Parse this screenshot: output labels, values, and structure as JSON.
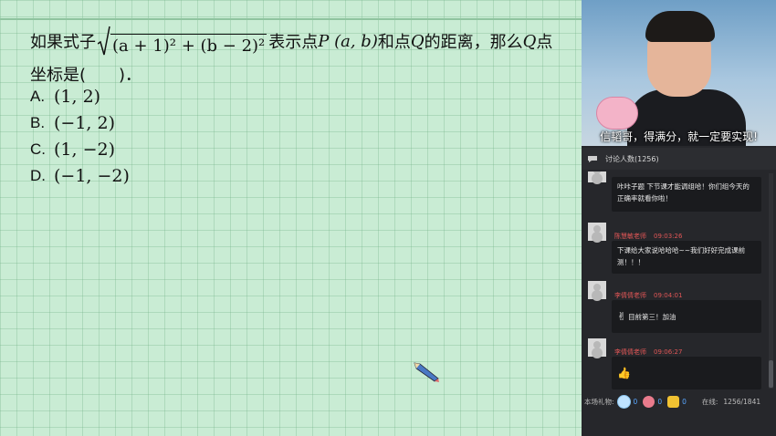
{
  "question": {
    "prefix": "如果式子",
    "radicand": "(a + 1)² + (b − 2)²",
    "middle": "表示点",
    "point_p": "P (a, b)",
    "middle2": "和点",
    "point_q": "Q",
    "suffix": "的距离，那么",
    "q2": "Q",
    "suffix2": "点",
    "line2": "坐标是(　　)．"
  },
  "options": [
    {
      "label": "A.",
      "value": "(1, 2)"
    },
    {
      "label": "B.",
      "value": "(−1, 2)"
    },
    {
      "label": "C.",
      "value": "(1, −2)"
    },
    {
      "label": "D.",
      "value": "(−1, −2)"
    }
  ],
  "video": {
    "caption": "信韬哥，得满分，就一定要实现!"
  },
  "chat": {
    "header": "讨论人数(1256)",
    "messages": [
      {
        "name": "",
        "time": "",
        "text": "咔咔子题 下节课才能调组哈！你们组今天的正确率就看你啦！",
        "icon": ""
      },
      {
        "name": "陈慧敏老师",
        "time": "09:03:26",
        "text": "下课给大家说哈哈哈~~我们好好完成课前测！！！",
        "icon": ""
      },
      {
        "name": "李倩倩老师",
        "time": "09:04:01",
        "text": "目前第三！加油",
        "icon": "victory-hand-icon"
      },
      {
        "name": "李倩倩老师",
        "time": "09:06:27",
        "text": "",
        "icon": "thumbs-up-icon"
      }
    ]
  },
  "footer": {
    "gifts_label": "本场礼物:",
    "gift_counts": [
      "0",
      "0",
      "0"
    ],
    "online_label": "在线:",
    "online_value": "1256/1841"
  },
  "colors": {
    "board": "#c9ecd4",
    "panel": "#26272b",
    "teacher_name": "#e05656",
    "count": "#58a6ff"
  }
}
